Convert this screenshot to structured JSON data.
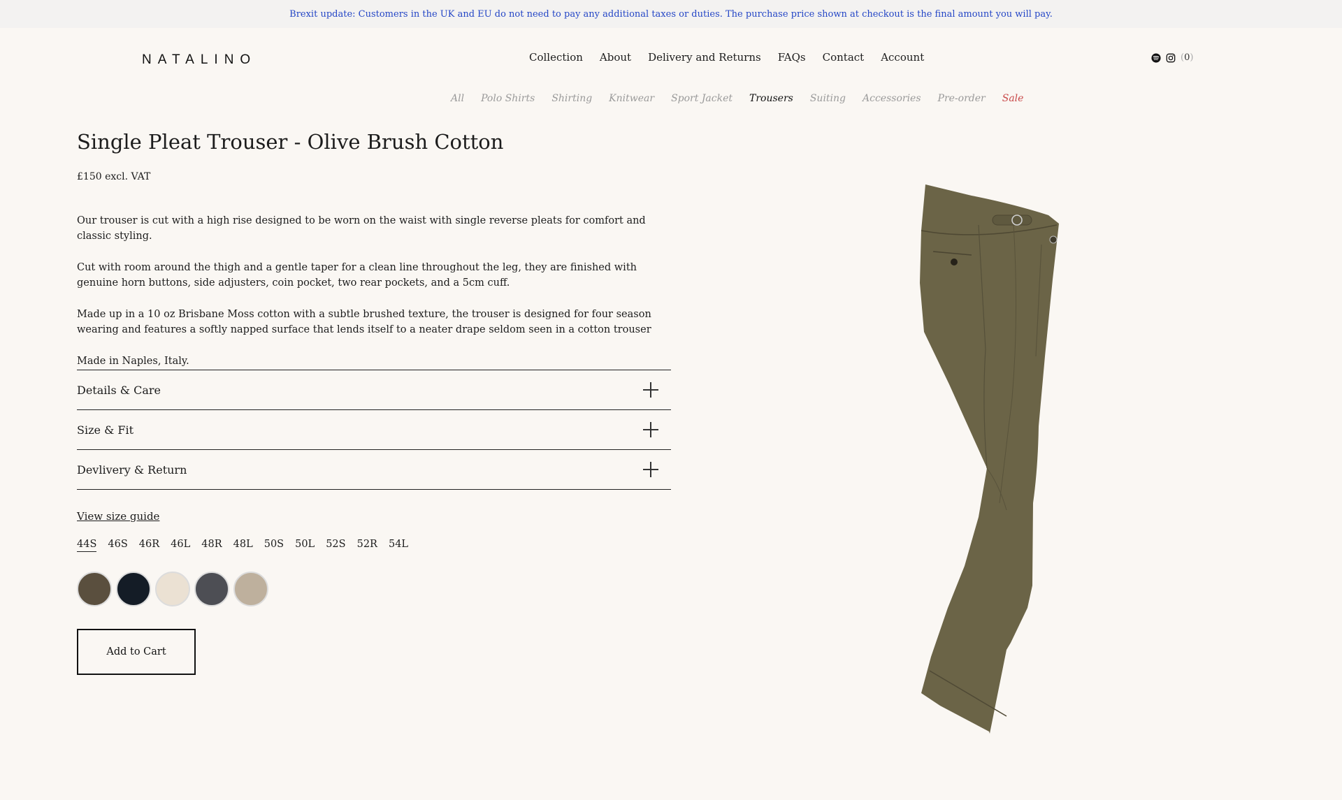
{
  "banner": {
    "text": "Brexit update: Customers in the UK and EU do not need to pay any additional taxes or duties. The purchase price shown at checkout is the final amount you will pay."
  },
  "header": {
    "logo": "NATALINO",
    "nav": [
      "Collection",
      "About",
      "Delivery and Returns",
      "FAQs",
      "Contact",
      "Account"
    ],
    "icons": [
      "spotify-icon",
      "instagram-icon"
    ],
    "cart_count": "0"
  },
  "categories": {
    "items": [
      "All",
      "Polo Shirts",
      "Shirting",
      "Knitwear",
      "Sport Jacket",
      "Trousers",
      "Suiting",
      "Accessories",
      "Pre-order",
      "Sale"
    ],
    "active": "Trousers",
    "sale_color": "#c94a4a"
  },
  "product": {
    "title": "Single Pleat Trouser - Olive Brush Cotton",
    "price": "£150 excl. VAT",
    "description": [
      "Our trouser is cut with a high rise designed to be worn on the waist with single reverse pleats for comfort and classic styling.",
      "Cut with room around the thigh and a gentle taper for a clean line throughout the leg, they are finished with genuine horn buttons, side adjusters, coin pocket, two rear pockets, and a 5cm cuff.",
      "Made up in a 10 oz Brisbane Moss cotton with a subtle brushed texture, the trouser is designed for four season wearing and features a softly napped surface that lends itself to a neater drape seldom seen in a cotton trouser",
      "Made in Naples, Italy."
    ],
    "accordion": [
      "Details & Care",
      "Size & Fit",
      "Devlivery & Return"
    ],
    "size_guide_label": "View size guide",
    "sizes": [
      "44S",
      "46S",
      "46R",
      "46L",
      "48R",
      "48L",
      "50S",
      "50L",
      "52S",
      "52R",
      "54L"
    ],
    "selected_size": "44S",
    "swatches": [
      "#5a4f3e",
      "#141c26",
      "#ebe1d3",
      "#4d4e54",
      "#beb09d"
    ],
    "add_to_cart_label": "Add to Cart",
    "image_color": "#6b6447"
  }
}
